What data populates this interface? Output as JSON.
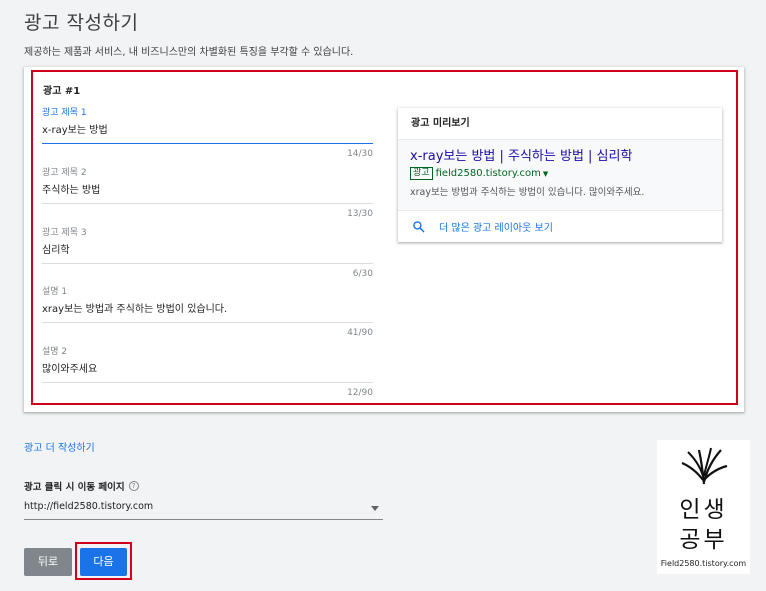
{
  "page": {
    "title": "광고 작성하기",
    "subtitle": "제공하는 제품과 서비스, 내 비즈니스만의 차별화된 특징을 부각할 수 있습니다."
  },
  "ad": {
    "heading": "광고 #1",
    "fields": [
      {
        "label": "광고 제목 1",
        "value": "x-ray보는 방법",
        "counter": "14/30"
      },
      {
        "label": "광고 제목 2",
        "value": "주식하는 방법",
        "counter": "13/30"
      },
      {
        "label": "광고 제목 3",
        "value": "심리학",
        "counter": "6/30"
      },
      {
        "label": "설명 1",
        "value": "xray보는 방법과 주식하는 방법이 있습니다.",
        "counter": "41/90"
      },
      {
        "label": "설명 2",
        "value": "많이와주세요",
        "counter": "12/90"
      }
    ]
  },
  "preview": {
    "header": "광고 미리보기",
    "title": "x-ray보는 방법 | 주식하는 방법 | 심리학",
    "badge": "광고",
    "url": "field2580.tistory.com",
    "description": "xray보는 방법과 주식하는 방법이 있습니다. 많이와주세요.",
    "more_layouts": "더 많은 광고 레이아웃 보기"
  },
  "more_ads_link": "광고 더 작성하기",
  "final_url": {
    "label": "광고 클릭 시 이동 페이지",
    "help_glyph": "?",
    "value": "http://field2580.tistory.com"
  },
  "buttons": {
    "back": "뒤로",
    "next": "다음"
  },
  "watermark": {
    "line1": "인생",
    "line2": "공부",
    "caption": "Field2580.tistory.com"
  },
  "colors": {
    "accent": "#1a73e8",
    "highlight_frame": "#d0021b",
    "ad_title": "#1a0dab",
    "ad_url": "#006621"
  }
}
